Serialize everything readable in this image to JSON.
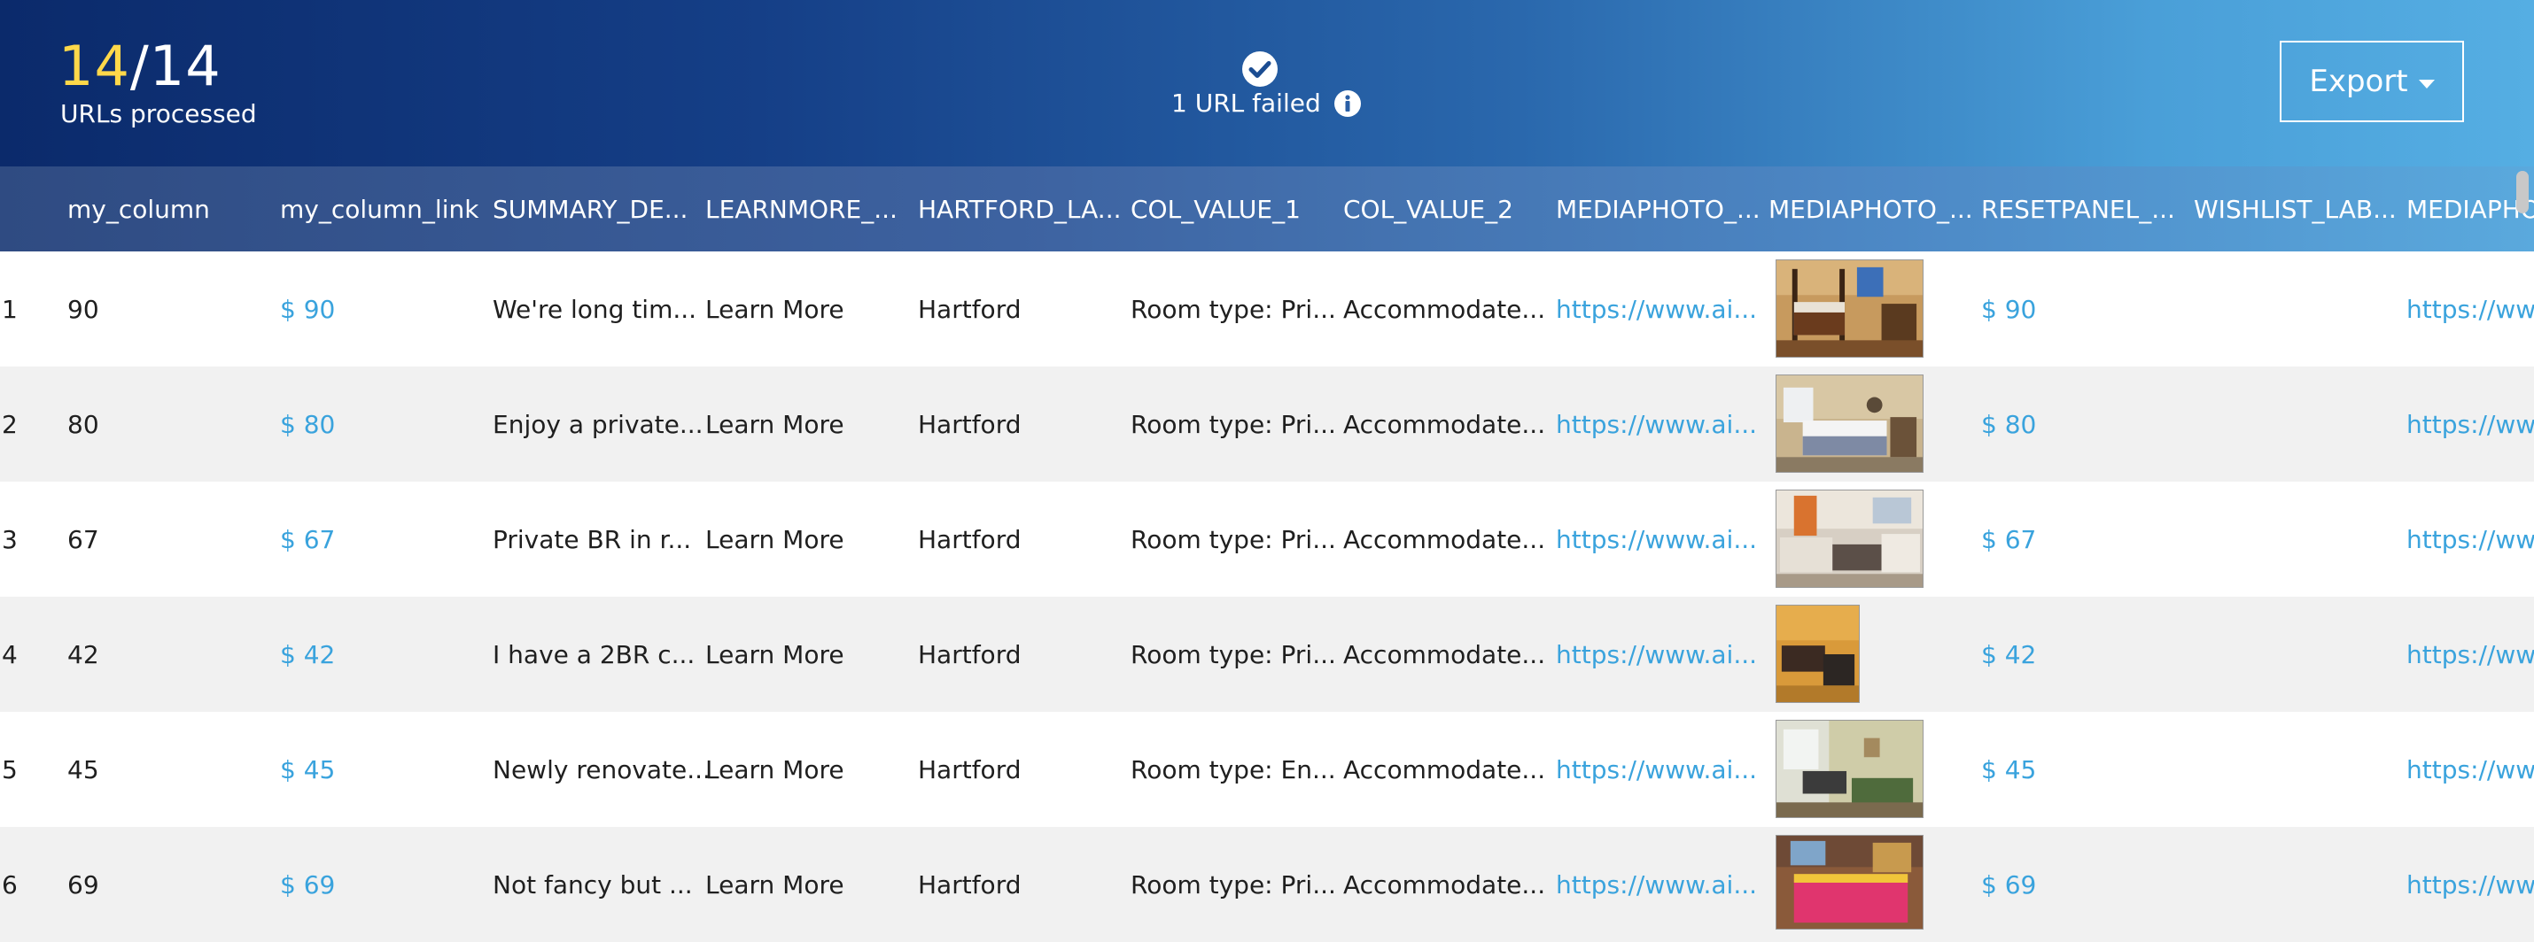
{
  "summary": {
    "processed_done": "14",
    "slash": "/",
    "processed_total": "14",
    "processed_label": "URLs processed",
    "failed_text": "1 URL failed",
    "status_icon": "check-circle-icon",
    "info_icon": "info-icon"
  },
  "toolbar": {
    "export_label": "Export"
  },
  "colors": {
    "highlight_count": "#ffd84a",
    "link": "#3aa3dd",
    "row_alt": "#f1f1f1"
  },
  "table": {
    "columns": [
      "my_column",
      "my_column_link",
      "SUMMARY_DE...",
      "LEARNMORE_...",
      "HARTFORD_LA...",
      "COL_VALUE_1",
      "COL_VALUE_2",
      "MEDIAPHOTO_...",
      "MEDIAPHOTO_...",
      "RESETPANEL_...",
      "WISHLIST_LAB...",
      "MEDIAPHO"
    ],
    "rows": [
      {
        "num": "1",
        "my_column": "90",
        "link": "$ 90",
        "summary": "We're long tim...",
        "learn": "Learn More",
        "hartford": "Hartford",
        "col1": "Room type: Pri...",
        "col2": "Accommodate...",
        "media_url": "https://www.ai...",
        "photo": "room-photo-bedroom-wood-bed",
        "reset": "$ 90",
        "wishlist": "",
        "media2": "https://www"
      },
      {
        "num": "2",
        "my_column": "80",
        "link": "$ 80",
        "summary": "Enjoy a private...",
        "learn": "Learn More",
        "hartford": "Hartford",
        "col1": "Room type: Pri...",
        "col2": "Accommodate...",
        "media_url": "https://www.ai...",
        "photo": "room-photo-bedroom-white-bed",
        "reset": "$ 80",
        "wishlist": "",
        "media2": "https://www"
      },
      {
        "num": "3",
        "my_column": "67",
        "link": "$ 67",
        "summary": "Private BR in r...",
        "learn": "Learn More",
        "hartford": "Hartford",
        "col1": "Room type: Pri...",
        "col2": "Accommodate...",
        "media_url": "https://www.ai...",
        "photo": "room-photo-living-room",
        "reset": "$ 67",
        "wishlist": "",
        "media2": "https://www"
      },
      {
        "num": "4",
        "my_column": "42",
        "link": "$ 42",
        "summary": "I have a 2BR c...",
        "learn": "Learn More",
        "hartford": "Hartford",
        "col1": "Room type: Pri...",
        "col2": "Accommodate...",
        "media_url": "https://www.ai...",
        "photo": "room-photo-orange-room",
        "reset": "$ 42",
        "wishlist": "",
        "media2": "https://www"
      },
      {
        "num": "5",
        "my_column": "45",
        "link": "$ 45",
        "summary": "Newly renovate...",
        "learn": "Learn More",
        "hartford": "Hartford",
        "col1": "Room type: En...",
        "col2": "Accommodate...",
        "media_url": "https://www.ai...",
        "photo": "room-photo-apartment",
        "reset": "$ 45",
        "wishlist": "",
        "media2": "https://www"
      },
      {
        "num": "6",
        "my_column": "69",
        "link": "$ 69",
        "summary": "Not fancy but ...",
        "learn": "Learn More",
        "hartford": "Hartford",
        "col1": "Room type: Pri...",
        "col2": "Accommodate...",
        "media_url": "https://www.ai...",
        "photo": "room-photo-red-bed",
        "reset": "$ 69",
        "wishlist": "",
        "media2": "https://www"
      }
    ]
  }
}
